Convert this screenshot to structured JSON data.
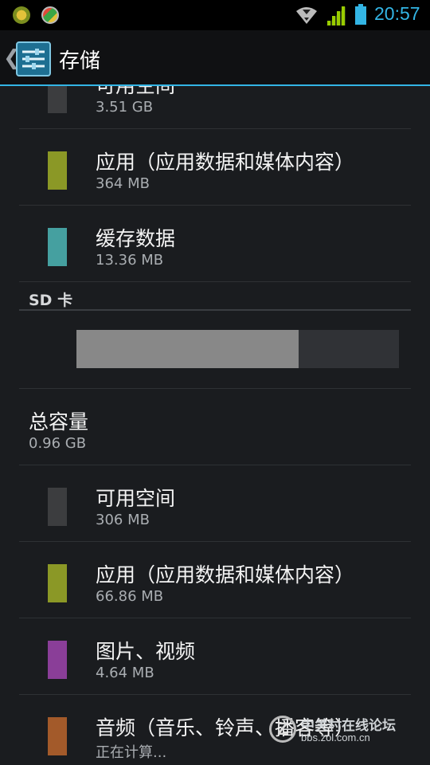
{
  "status_bar": {
    "time": "20:57",
    "colors": {
      "accent": "#33b5e5",
      "signal": "#99cc00"
    },
    "icons": [
      "notification-icon",
      "app-notification-icon",
      "wifi-icon",
      "signal-icon",
      "battery-icon"
    ]
  },
  "action_bar": {
    "back_icon": "chevron-left-icon",
    "app_icon": "settings-icon",
    "title": "存储"
  },
  "internal_items": [
    {
      "title": "可用空间",
      "size": "3.51 GB",
      "color": "#3c3d3f"
    },
    {
      "title": "应用（应用数据和媒体内容）",
      "size": "364 MB",
      "color": "#8b9826"
    },
    {
      "title": "缓存数据",
      "size": "13.36 MB",
      "color": "#45a0a0"
    }
  ],
  "sd_section": {
    "header": "SD 卡",
    "usage_fraction": 0.69,
    "total_label": "总容量",
    "total_value": "0.96 GB",
    "items": [
      {
        "title": "可用空间",
        "size": "306 MB",
        "color": "#3c3d3f"
      },
      {
        "title": "应用（应用数据和媒体内容）",
        "size": "66.86 MB",
        "color": "#8b9826"
      },
      {
        "title": "图片、视频",
        "size": "4.64 MB",
        "color": "#8a3e98"
      },
      {
        "title": "音频（音乐、铃声、播客等）",
        "size": "正在计算...",
        "color": "#a35a2a"
      }
    ]
  },
  "watermark": {
    "logo": "Z",
    "line1": "中关村在线论坛",
    "line2": "bbs.zol.com.cn"
  }
}
